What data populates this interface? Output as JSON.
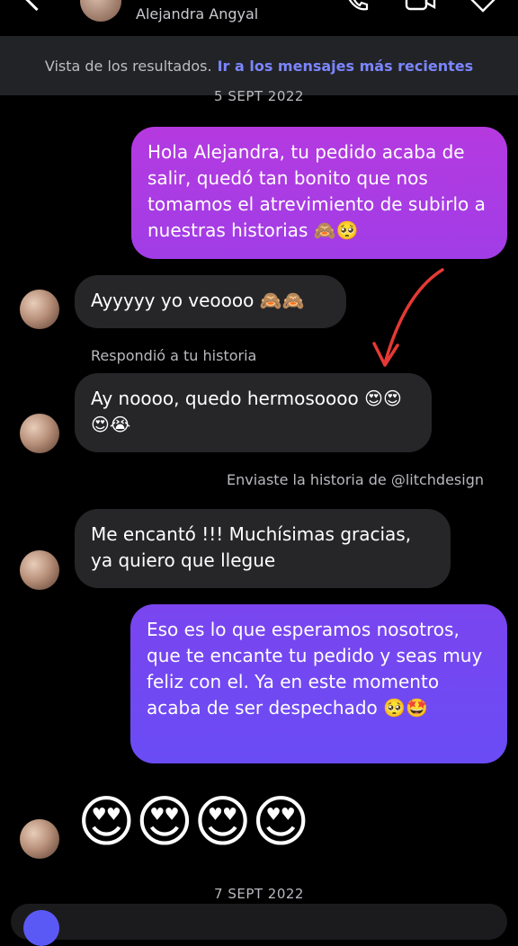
{
  "header": {
    "contact_name": "Alejandra Angyal"
  },
  "banner": {
    "text": "Vista de los resultados.",
    "link": "Ir a los mensajes más recientes"
  },
  "dates": [
    "5 SEPT 2022",
    "7 SEPT 2022"
  ],
  "messages": {
    "m1": "Hola Alejandra, tu pedido acaba de salir, quedó tan bonito que nos tomamos el atrevimiento de subirlo a nuestras historias 🙈🥺",
    "m2": "Ayyyyy yo veoooo 🙈🙈",
    "m3_label": "Respondió a tu historia",
    "m3": "Ay noooo, quedo hermosoooo 😍😍😍😭",
    "m4_label": "Enviaste la historia de @litchdesign",
    "m5": "Me encantó !!! Muchísimas gracias, ya quiero que llegue",
    "m6": "Eso es lo que esperamos nosotros, que te encante tu pedido y seas muy feliz con el. Ya en este momento acaba de ser despechado 🥺🤩",
    "m7": "😍😍😍😍"
  },
  "colors": {
    "sent_top": "#b53ae0",
    "sent_mid": "#8b3fe8",
    "sent_bottom": "#6a4cf5",
    "received": "#262628",
    "link": "#7b86ff",
    "annotation_arrow": "#e53935"
  },
  "icons": [
    "back-chevron-icon",
    "phone-icon",
    "video-icon",
    "heart-icon",
    "camera-icon",
    "annotation-arrow"
  ]
}
